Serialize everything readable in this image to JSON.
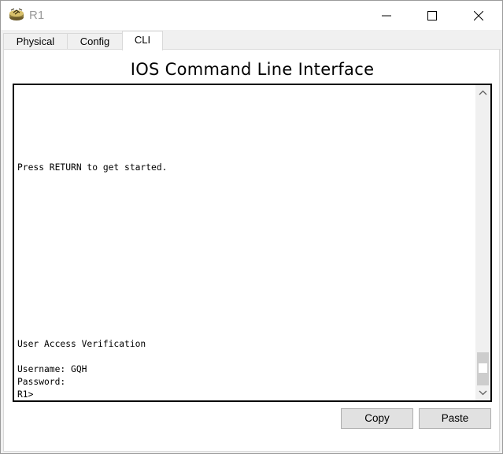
{
  "window": {
    "title": "R1",
    "icon": "router-icon"
  },
  "tabs": [
    {
      "label": "Physical",
      "active": false
    },
    {
      "label": "Config",
      "active": false
    },
    {
      "label": "CLI",
      "active": true
    }
  ],
  "main": {
    "heading": "IOS Command Line Interface",
    "terminal": {
      "lines": [
        "Press RETURN to get started.",
        "User Access Verification",
        "Username: GQH",
        "Password:",
        "R1>"
      ]
    },
    "scrollbar": {
      "position_fraction": 1.0
    }
  },
  "buttons": {
    "copy_label": "Copy",
    "paste_label": "Paste"
  },
  "colors": {
    "window_bg": "#f0f0f0",
    "terminal_border": "#000000",
    "button_bg": "#e1e1e1"
  }
}
